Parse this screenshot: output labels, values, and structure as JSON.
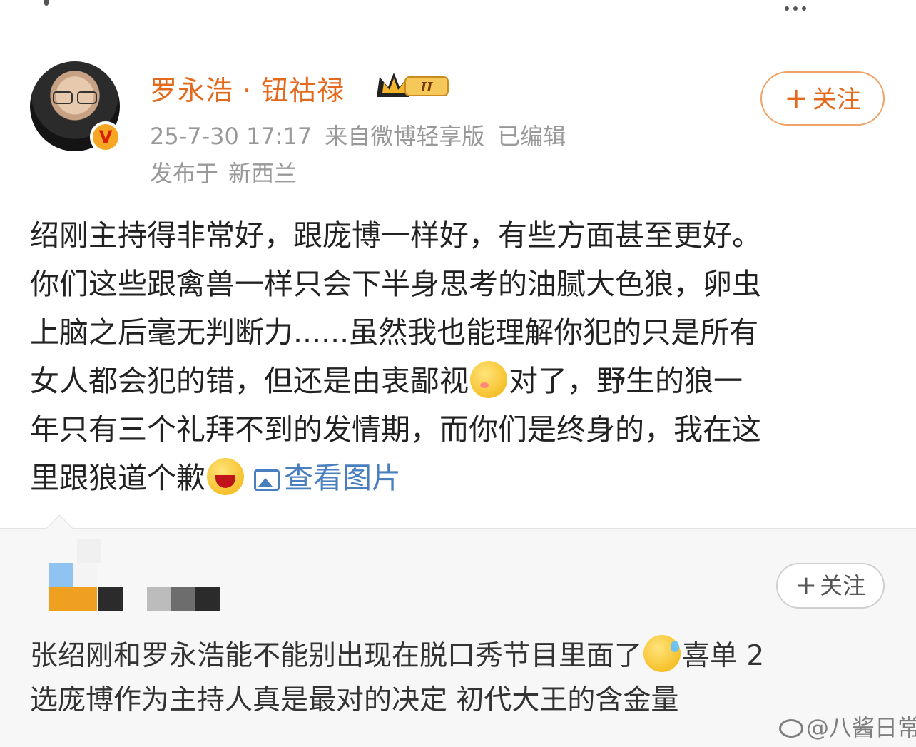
{
  "post": {
    "author": "罗永浩 · 钮祜禄",
    "level_badge": "II",
    "verified_badge": "V",
    "timestamp": "25-7-30 17:17",
    "source": "来自微博轻享版",
    "edited": "已编辑",
    "location_prefix": "发布于",
    "location": "新西兰",
    "follow_label": "关注",
    "follow_plus": "+",
    "lines": [
      "绍刚主持得非常好，跟庞博一样好，有些方面甚至更好。",
      "你们这些跟禽兽一样只会下半身思考的油腻大色狼，卵虫",
      "上脑之后毫无判断力......虽然我也能理解你犯的只是所有"
    ],
    "line4_a": "女人都会犯的错，但还是由衷鄙视",
    "line4_b": "对了，野生的狼一",
    "line5": "年只有三个礼拜不到的发情期，而你们是终身的，我在这",
    "line6": "里跟狼道个歉",
    "view_images": "查看图片",
    "emojis": [
      "smirk-emoji",
      "laugh-emoji"
    ]
  },
  "repost": {
    "follow_label": "关注",
    "follow_plus": "+",
    "line1_a": "张绍刚和罗永浩能不能别出现在脱口秀节目里面了",
    "line1_b": "喜单 2",
    "line2": "选庞博作为主持人真是最对的决定 初代大王的含金量",
    "emoji": "sweat-emoji"
  },
  "watermark": "@八酱日常",
  "colors": {
    "username": "#e36a1c",
    "meta": "#999999",
    "link": "#4a7fbf",
    "repost_bg": "#f7f7f7"
  }
}
